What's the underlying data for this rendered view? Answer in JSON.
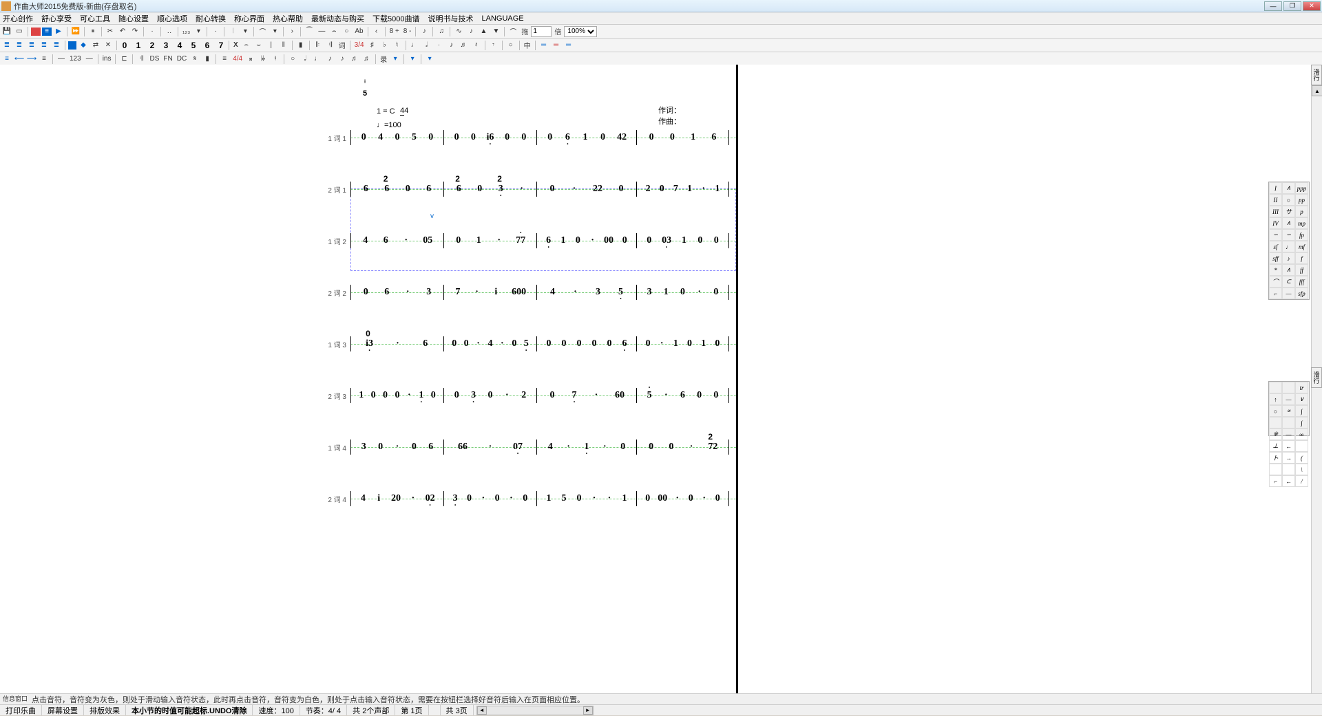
{
  "window": {
    "title": "作曲大师2015免费版-新曲(存盘取名)"
  },
  "menu": [
    "开心创作",
    "舒心享受",
    "可心工具",
    "随心设置",
    "顺心选项",
    "耐心转换",
    "称心界面",
    "热心帮助",
    "最新动态与购买",
    "下载5000曲谱",
    "说明书与技术",
    "LANGUAGE"
  ],
  "tb1": {
    "drag": "拖",
    "spin": "1",
    "spin_unit": "倍",
    "zoom": "100%",
    "eight_plus": "8 +",
    "eight_minus": "8 -"
  },
  "tb2": {
    "nums": [
      "0",
      "1",
      "2",
      "3",
      "4",
      "5",
      "6",
      "7"
    ],
    "x": "X",
    "lyric": "词",
    "ts34": "3/4",
    "mid": "中"
  },
  "tb3": {
    "oneTwoThree": "123",
    "ins": "ins",
    "ts44": "4/4",
    "ds": "DS",
    "fn": "FN",
    "dc": "DC",
    "rec": "录"
  },
  "score": {
    "topnote": "5",
    "key": "1 = C",
    "ts_num": "4",
    "ts_den": "4",
    "tempo": "♩=100",
    "credit_lyric": "作词：",
    "credit_music": "作曲：",
    "rows": [
      {
        "label": "1 词 1",
        "bars": [
          [
            "0",
            "4",
            "0",
            "5",
            "0"
          ],
          [
            "0",
            "0",
            "i6̣",
            "0",
            "0"
          ],
          [
            "0",
            "6̣",
            "1",
            "0",
            "42"
          ],
          [
            "0",
            "0",
            "1",
            "6"
          ]
        ]
      },
      {
        "label": "2 词 1",
        "bars": [
          [
            "6",
            "6²",
            "0",
            "6"
          ],
          [
            "6²",
            "0",
            "3̣²",
            "·"
          ],
          [
            "0",
            "·",
            "22",
            "0"
          ],
          [
            "2",
            "0",
            "7",
            "1",
            "·",
            "1"
          ]
        ],
        "stacked": true
      },
      {
        "label": "1 词 2",
        "bars": [
          [
            "4",
            "6",
            "·",
            "05"
          ],
          [
            "0",
            "1",
            "·",
            "77̇"
          ],
          [
            "6̣",
            "1",
            "0",
            "·",
            "00",
            "0"
          ],
          [
            "0",
            "03̣",
            "1",
            "0",
            "0"
          ]
        ]
      },
      {
        "label": "2 词 2",
        "bars": [
          [
            "0",
            "6",
            "·",
            "3"
          ],
          [
            "7",
            "·",
            "i",
            "600"
          ],
          [
            "4",
            "·",
            "3",
            "5̣"
          ],
          [
            "3",
            "1",
            "0",
            "·",
            "0"
          ]
        ]
      },
      {
        "label": "1 词 3",
        "bars": [
          [
            "i3̣⁰",
            "·",
            "6"
          ],
          [
            "0",
            "0",
            "·",
            "4",
            "·",
            "0",
            "5̣"
          ],
          [
            "0",
            "0",
            "0",
            "0",
            "0",
            "6̣"
          ],
          [
            "0",
            "·",
            "1",
            "0",
            "1",
            "0"
          ]
        ]
      },
      {
        "label": "2 词 3",
        "bars": [
          [
            "1",
            "0",
            "0",
            "0",
            "·",
            "1̣",
            "0"
          ],
          [
            "0",
            "3̣",
            "0",
            "·",
            "2"
          ],
          [
            "0",
            "7̣",
            "·",
            "60"
          ],
          [
            "5̇",
            "·",
            "6",
            "0",
            "0"
          ]
        ]
      },
      {
        "label": "1 词 4",
        "bars": [
          [
            "3",
            "0",
            "·",
            "0",
            "6"
          ],
          [
            "66",
            "·",
            "07̣"
          ],
          [
            "4",
            "·",
            "1̣",
            "·",
            "0"
          ],
          [
            "0",
            "0",
            "·",
            "72²"
          ]
        ]
      },
      {
        "label": "2 词 4",
        "bars": [
          [
            "4",
            "i",
            "20",
            "·",
            "02̣"
          ],
          [
            "3̣",
            "0",
            "·",
            "0",
            "·",
            "0"
          ],
          [
            "1",
            "5",
            "0",
            "·",
            "·",
            "1"
          ],
          [
            "0",
            "00",
            "·",
            "0",
            "·",
            "0"
          ]
        ],
        "leading": true
      }
    ]
  },
  "palette": {
    "col1": [
      "I",
      "II",
      "III",
      "IV",
      "∽",
      "sf",
      "sff",
      "*",
      "⌒",
      "⌐",
      "—",
      "",
      "↑",
      "○",
      "",
      "※",
      "⊥",
      "ト",
      "",
      "⌐"
    ],
    "col2": [
      "∧",
      "○",
      "サ",
      "∧",
      "∽",
      "♩",
      "♪",
      "∧",
      "⊂",
      "—",
      "·",
      "",
      "—",
      "∝",
      "",
      "—",
      "←",
      "→",
      "",
      "←"
    ],
    "col3": [
      "ppp",
      "pp",
      "p",
      "mp",
      "fp",
      "mf",
      "f",
      "ff",
      "fff",
      "sfp",
      "",
      "tr",
      "∨",
      "∫",
      "∫",
      "∞",
      "",
      "(",
      "\\",
      "/",
      "//"
    ]
  },
  "hint": {
    "label": "信息窗口",
    "text": "点击音符，音符变为灰色，则处于滑动输入音符状态，此时再点击音符，音符变为白色，则处于点击输入音符状态，需要在按钮栏选择好音符后输入在页面相应位置。"
  },
  "status": {
    "segs": [
      "打印乐曲",
      "屏幕设置",
      "排版效果",
      "本小节的时值可能超标.UNDO清除",
      "速度：100",
      "节奏：4/ 4",
      "共 2个声部",
      "第 1页",
      "",
      "共 3页"
    ]
  }
}
